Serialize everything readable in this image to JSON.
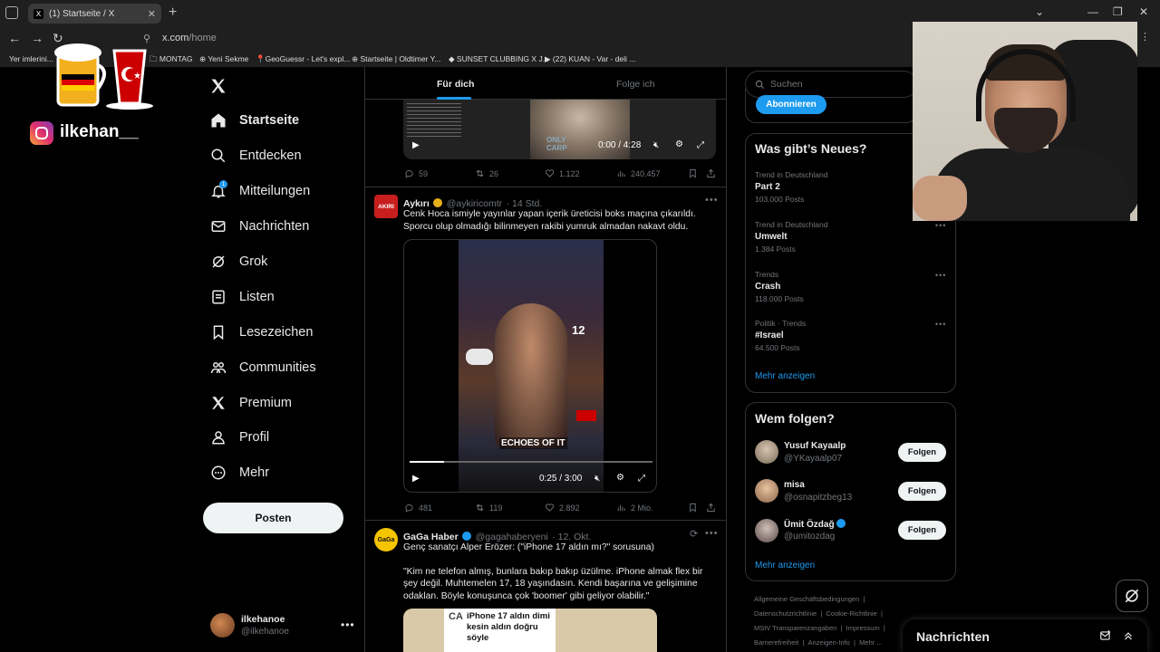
{
  "browser": {
    "tab_title": "(1) Startseite / X",
    "url_host": "x.com",
    "url_path": "/home",
    "bookmarks": [
      "Yer imlerini...",
      "MONTAG",
      "Yeni Sekme",
      "GeoGuessr - Let's expl...",
      "Startseite | Oldtimer Y...",
      "SUNSET CLUBBING X J...",
      "(22) KUAN - Var - deli ..."
    ]
  },
  "overlay": {
    "instagram_handle": "ilkehan__"
  },
  "nav": {
    "items": [
      {
        "label": "Startseite",
        "icon": "home-icon"
      },
      {
        "label": "Entdecken",
        "icon": "search-icon"
      },
      {
        "label": "Mitteilungen",
        "icon": "bell-icon",
        "badge": "1"
      },
      {
        "label": "Nachrichten",
        "icon": "mail-icon"
      },
      {
        "label": "Grok",
        "icon": "grok-icon"
      },
      {
        "label": "Listen",
        "icon": "list-icon"
      },
      {
        "label": "Lesezeichen",
        "icon": "bookmark-icon"
      },
      {
        "label": "Communities",
        "icon": "communities-icon"
      },
      {
        "label": "Premium",
        "icon": "x-icon"
      },
      {
        "label": "Profil",
        "icon": "profile-icon"
      },
      {
        "label": "Mehr",
        "icon": "more-icon"
      }
    ],
    "post_button": "Posten",
    "profile": {
      "name": "ilkehanoe",
      "handle": "@ilkehanoe"
    }
  },
  "feed": {
    "tabs": [
      "Für dich",
      "Folge ich"
    ],
    "tweet0": {
      "video_time": "0:00 / 4:28",
      "stats": {
        "replies": "59",
        "reposts": "26",
        "likes": "1.122",
        "views": "240.457"
      }
    },
    "tweet1": {
      "name": "Aykırı",
      "handle": "@aykiricomtr",
      "time": "· 14 Std.",
      "avatar_text": "AKIRI",
      "text_line1": "Cenk Hoca ismiyle yayınlar yapan içerik üreticisi boks maçına çıkarıldı.",
      "text_line2": "Sporcu olup olmadığı bilinmeyen rakibi yumruk almadan nakavt oldu.",
      "video_caption": "ECHOES OF IT",
      "video_sign": "12",
      "video_time": "0:25 / 3:00",
      "video_progress": 0.14,
      "stats": {
        "replies": "481",
        "reposts": "119",
        "likes": "2.892",
        "views": "2 Mio."
      }
    },
    "tweet2": {
      "name": "GaGa Haber",
      "handle": "@gagahaberyeni",
      "time": "· 12. Okt.",
      "avatar_text": "GaGa",
      "text_line1": "Genç sanatçı Alper Erözer: (\"iPhone 17 aldın mı?\" sorusuna)",
      "quote_line1": "\"Kim ne telefon almış, bunlara bakıp bakıp üzülme. iPhone almak flex bir",
      "quote_line2": "şey değil. Muhtemelen 17, 18 yaşındasın. Kendi başarına ve gelişimine",
      "quote_line3": "odaklan. Böyle konuşunca çok 'boomer' gibi geliyor olabilir.\"",
      "media_logo": "CA",
      "media_line1": "iPhone 17 aldın dimi",
      "media_line2": "kesin aldın doğru",
      "media_line3": "söyle"
    }
  },
  "right": {
    "search_placeholder": "Suchen",
    "subscribe_button": "Abonnieren",
    "whats_new_title": "Was gibt’s Neues?",
    "trends": [
      {
        "category": "Trend in Deutschland",
        "name": "Part 2",
        "count": "103.000 Posts"
      },
      {
        "category": "Trend in Deutschland",
        "name": "Umwelt",
        "count": "1.384 Posts"
      },
      {
        "category": "Trends",
        "name": "Crash",
        "count": "118.000 Posts"
      },
      {
        "category": "Politik · Trends",
        "name": "#Israel",
        "count": "64.500 Posts"
      }
    ],
    "trends_more": "Mehr anzeigen",
    "who_to_follow_title": "Wem folgen?",
    "who_to_follow": [
      {
        "name": "Yusuf Kayaalp",
        "handle": "@YKayaalp07",
        "button": "Folgen"
      },
      {
        "name": "misa",
        "handle": "@osnapitzbeg13",
        "button": "Folgen"
      },
      {
        "name": "Ümit Özdağ",
        "handle": "@umitozdag",
        "button": "Folgen"
      }
    ],
    "follow_more": "Mehr anzeigen",
    "footer": {
      "row1": [
        "Allgemeine Geschäftsbedingungen",
        "|"
      ],
      "row2": [
        "Datenschutzrichtlinie",
        "|",
        "Cookie-Richtlinie",
        "|"
      ],
      "row3": [
        "MStV Transparenzangaben",
        "|",
        "Impressum",
        "|"
      ],
      "row4": [
        "Barrierefreiheit",
        "|",
        "Anzeigen-Info",
        "|",
        "Mehr ..."
      ]
    },
    "messages_title": "Nachrichten"
  },
  "colors": {
    "accent": "#1d9bf0",
    "background": "#000000",
    "border": "#2f3336",
    "muted_text": "#71767b"
  }
}
